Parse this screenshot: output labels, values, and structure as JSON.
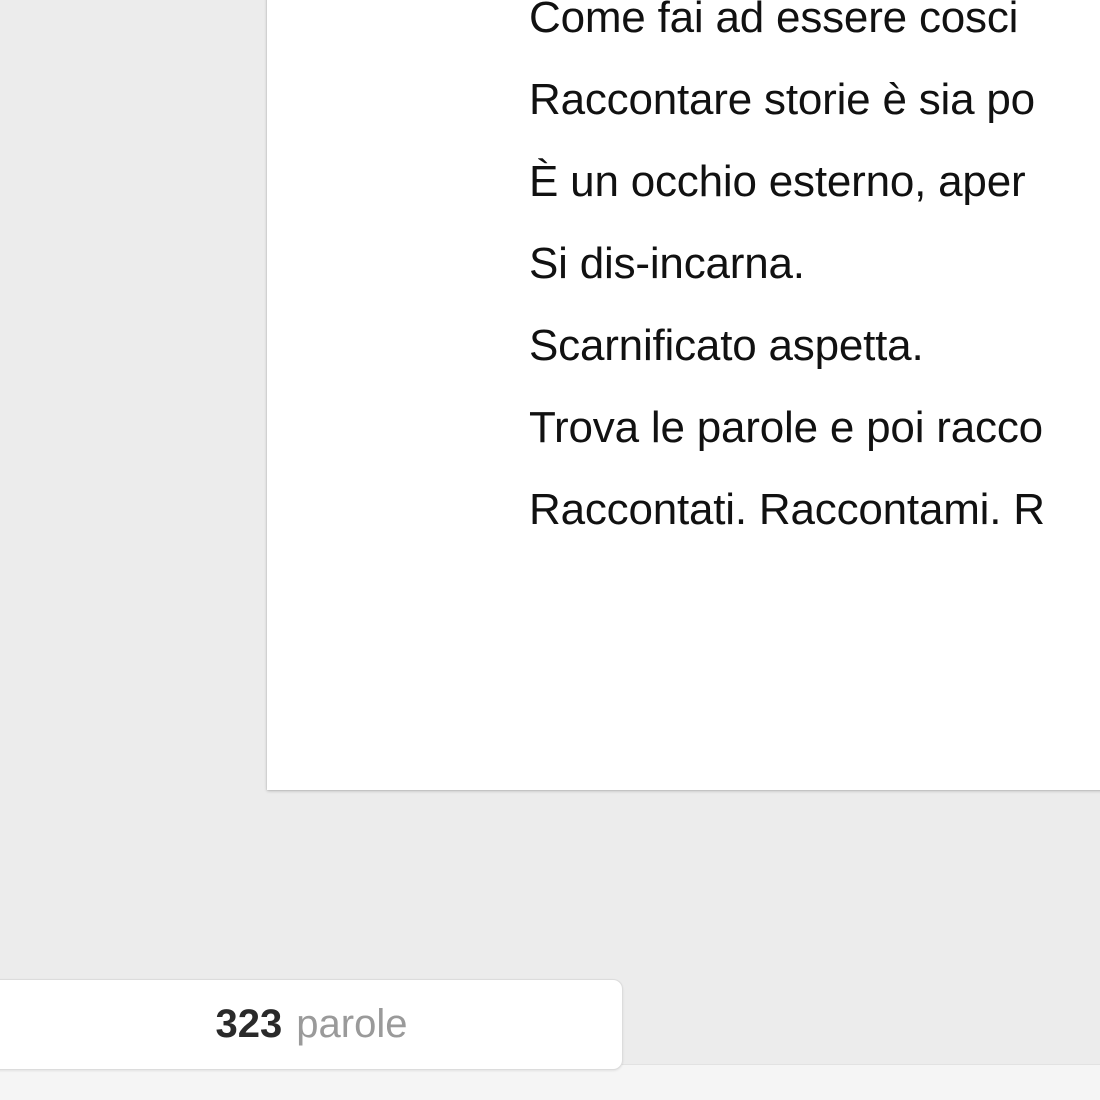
{
  "document": {
    "lines": [
      "Come fai ad essere cosci",
      "Raccontare storie è sia po",
      "È un occhio esterno, aper",
      "Si dis-incarna.",
      "Scarnificato aspetta.",
      "Trova le parole e poi racco",
      "Raccontati. Raccontami. R"
    ]
  },
  "status": {
    "word_count": "323",
    "word_unit": "parole"
  }
}
